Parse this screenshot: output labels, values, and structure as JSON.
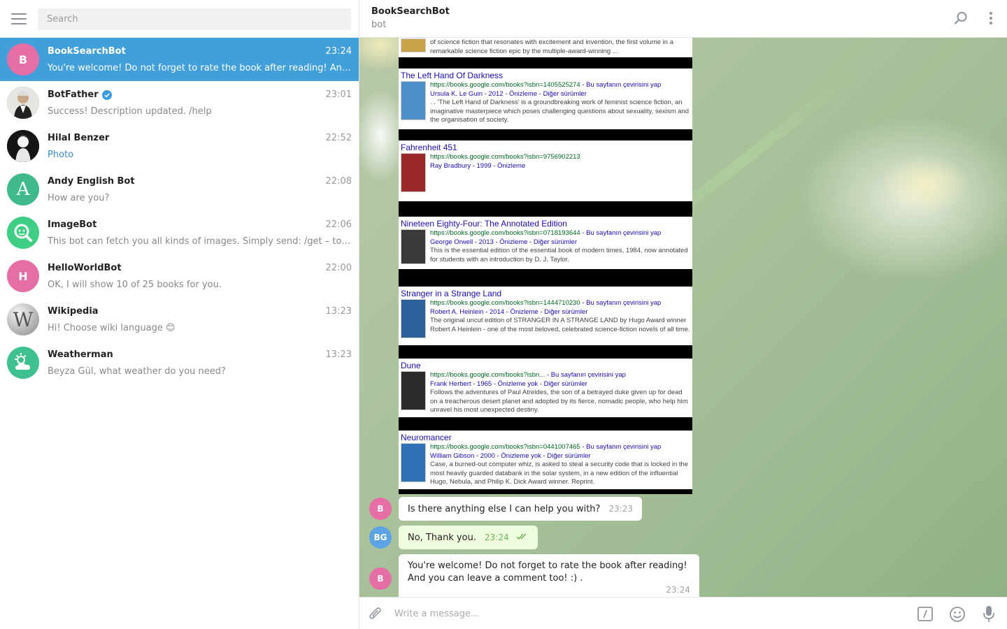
{
  "search": {
    "placeholder": "Search"
  },
  "chats": [
    {
      "name": "BookSearchBot",
      "time": "23:24",
      "message": "You're welcome! Do not forget to rate the book after reading! And you can leave a comment too! :) .",
      "avatar_letter": "B",
      "avatar_color": "#e66ea6",
      "active": true
    },
    {
      "name": "BotFather",
      "time": "23:01",
      "message": "Success! Description updated. /help",
      "avatar_letter": "",
      "avatar_color": "#556070",
      "verified": true
    },
    {
      "name": "Hilal Benzer",
      "time": "22:52",
      "message": "Photo",
      "avatar_letter": "",
      "avatar_color": "#1f1f1f"
    },
    {
      "name": "Andy English Bot",
      "time": "22:08",
      "message": "How are you?",
      "avatar_letter": "A",
      "avatar_color": "#3fba8c"
    },
    {
      "name": "ImageBot",
      "time": "22:06",
      "message": "This bot can fetch you all kinds of images. Simply send: /get – to find a random image",
      "avatar_letter": "",
      "avatar_color": "#3ecf84"
    },
    {
      "name": "HelloWorldBot",
      "time": "22:00",
      "message": "OK, I will show 10 of 25 books for you.",
      "avatar_letter": "H",
      "avatar_color": "#e66ea6"
    },
    {
      "name": "Wikipedia",
      "time": "13:23",
      "message": "Hi! Choose wiki language 😊",
      "avatar_letter": "W",
      "avatar_color": "#9e9e9e"
    },
    {
      "name": "Weatherman",
      "time": "13:23",
      "message": "Beyza Gül, what weather do you need?",
      "avatar_letter": "",
      "avatar_color": "#3ec18e"
    }
  ],
  "header": {
    "title": "BookSearchBot",
    "status": "bot"
  },
  "books": [
    {
      "title": "",
      "url": "",
      "meta": "",
      "desc": "of science fiction that resonates with excitement and invention, the first volume in a remarkable science fiction epic by the multiple-award-winning ...",
      "cover": "#c9a24a"
    },
    {
      "title": "The Left Hand Of Darkness",
      "url": "https://books.google.com/books?isbn=1405525274",
      "url_extra": "- Bu sayfanın çevirisini yap",
      "meta": "Ursula K. Le Guin - 2012 - Önizleme - Diğer sürümler",
      "desc": ". . 'The Left Hand of Darkness' is a groundbreaking work of feminist science fiction, an imaginative masterpiece which poses challenging questions about sexuality, sexism and the organisation of society.",
      "cover": "#4f8fc9"
    },
    {
      "title": "Fahrenheit 451",
      "url": "https://books.google.com/books?isbn=9756902213",
      "url_extra": "",
      "meta": "Ray Bradbury - 1999 - Önizleme",
      "desc": "",
      "cover": "#9a2a2a"
    },
    {
      "title": "Nineteen Eighty-Four: The Annotated Edition",
      "url": "https://books.google.com/books?isbn=0718193644",
      "url_extra": "- Bu sayfanın çevirisini yap",
      "meta": "George Orwell - 2013 - Önizleme - Diğer sürümler",
      "desc": "This is the essential edition of the essential book of modern times, 1984, now annotated for students with an introduction by D. J. Taylor.",
      "cover": "#3a3a3a"
    },
    {
      "title": "Stranger in a Strange Land",
      "url": "https://books.google.com/books?isbn=1444710230",
      "url_extra": "- Bu sayfanın çevirisini yap",
      "meta": "Robert A. Heinlein - 2014 - Önizleme - Diğer sürümler",
      "desc": "The original uncut edition of STRANGER IN A STRANGE LAND by Hugo Award winner Robert A Heinlein - one of the most beloved, celebrated science-fiction novels of all time.",
      "cover": "#2d5f9a"
    },
    {
      "title": "Dune",
      "url": "https://books.google.com/books?isbn...",
      "url_extra": "- Bu sayfanın çevirisini yap",
      "meta": "Frank Herbert - 1965 - Önizleme yok - Diğer sürümler",
      "desc": "Follows the adventures of Paul Atreides, the son of a betrayed duke given up for dead on a treacherous desert planet and adopted by its fierce, nomadic people, who help him unravel his most unexpected destiny.",
      "cover": "#2a2a2a"
    },
    {
      "title": "Neuromancer",
      "url": "https://books.google.com/books?isbn=0441007465",
      "url_extra": "- Bu sayfanın çevirisini yap",
      "meta": "William Gibson - 2000 - Önizleme yok - Diğer sürümler",
      "desc": "Case, a burned-out computer whiz, is asked to steal a security code that is locked in the most heavily guarded databank in the solar system, in a new edition of the influential Hugo, Nebula, and Philip K. Dick Award winner. Reprint.",
      "cover": "#2f6fb3"
    }
  ],
  "messages": [
    {
      "from": "B",
      "avatar_color": "#e66ea6",
      "text": "Is there anything else I can help you with?",
      "time": "23:23",
      "outgoing": false
    },
    {
      "from": "BG",
      "avatar_color": "#5ca3e6",
      "text": "No, Thank you.",
      "time": "23:24",
      "outgoing": true
    },
    {
      "from": "B",
      "avatar_color": "#e66ea6",
      "text": "You're welcome! Do not forget to rate the book after reading! And you can leave a comment too! :) .",
      "time": "23:24",
      "outgoing": false
    }
  ],
  "composer": {
    "placeholder": "Write a message..."
  },
  "colors": {
    "accent": "#419fd9",
    "outgoing_bubble": "#effdde",
    "read_check": "#6cb35e"
  },
  "icons": [
    "menu-icon",
    "verified-icon",
    "search-icon",
    "more-vertical-icon",
    "attach-icon",
    "bot-command-icon",
    "emoji-icon",
    "microphone-icon",
    "double-check-icon"
  ]
}
